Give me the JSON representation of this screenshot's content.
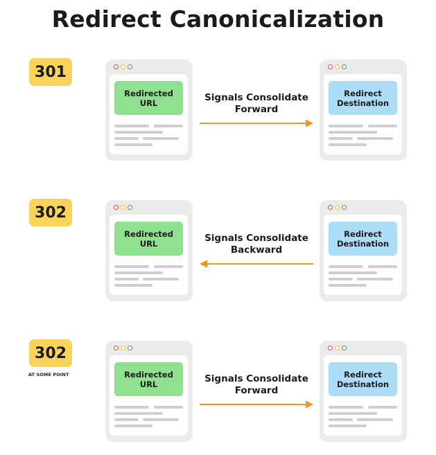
{
  "title": "Redirect Canonicalization",
  "colors": {
    "badge": "#F9D35C",
    "source_box": "#8FE08F",
    "destination_box": "#ADDCF7",
    "arrow": "#F7931E",
    "window_frame": "#EBEBEB",
    "placeholder_line": "#CFCFCF"
  },
  "rows": [
    {
      "status_code": "301",
      "note": "",
      "source": {
        "label_line1": "Redirected",
        "label_line2": "URL"
      },
      "destination": {
        "label_line1": "Redirect",
        "label_line2": "Destination"
      },
      "signal": {
        "line1": "Signals Consolidate",
        "line2": "Forward",
        "direction": "forward"
      }
    },
    {
      "status_code": "302",
      "note": "",
      "source": {
        "label_line1": "Redirected",
        "label_line2": "URL"
      },
      "destination": {
        "label_line1": "Redirect",
        "label_line2": "Destination"
      },
      "signal": {
        "line1": "Signals Consolidate",
        "line2": "Backward",
        "direction": "backward"
      }
    },
    {
      "status_code": "302",
      "note": "AT SOME POINT",
      "source": {
        "label_line1": "Redirected",
        "label_line2": "URL"
      },
      "destination": {
        "label_line1": "Redirect",
        "label_line2": "Destination"
      },
      "signal": {
        "line1": "Signals Consolidate",
        "line2": "Forward",
        "direction": "forward"
      }
    }
  ],
  "window_icons": [
    "close-dot-icon",
    "minimize-dot-icon",
    "maximize-dot-icon"
  ]
}
